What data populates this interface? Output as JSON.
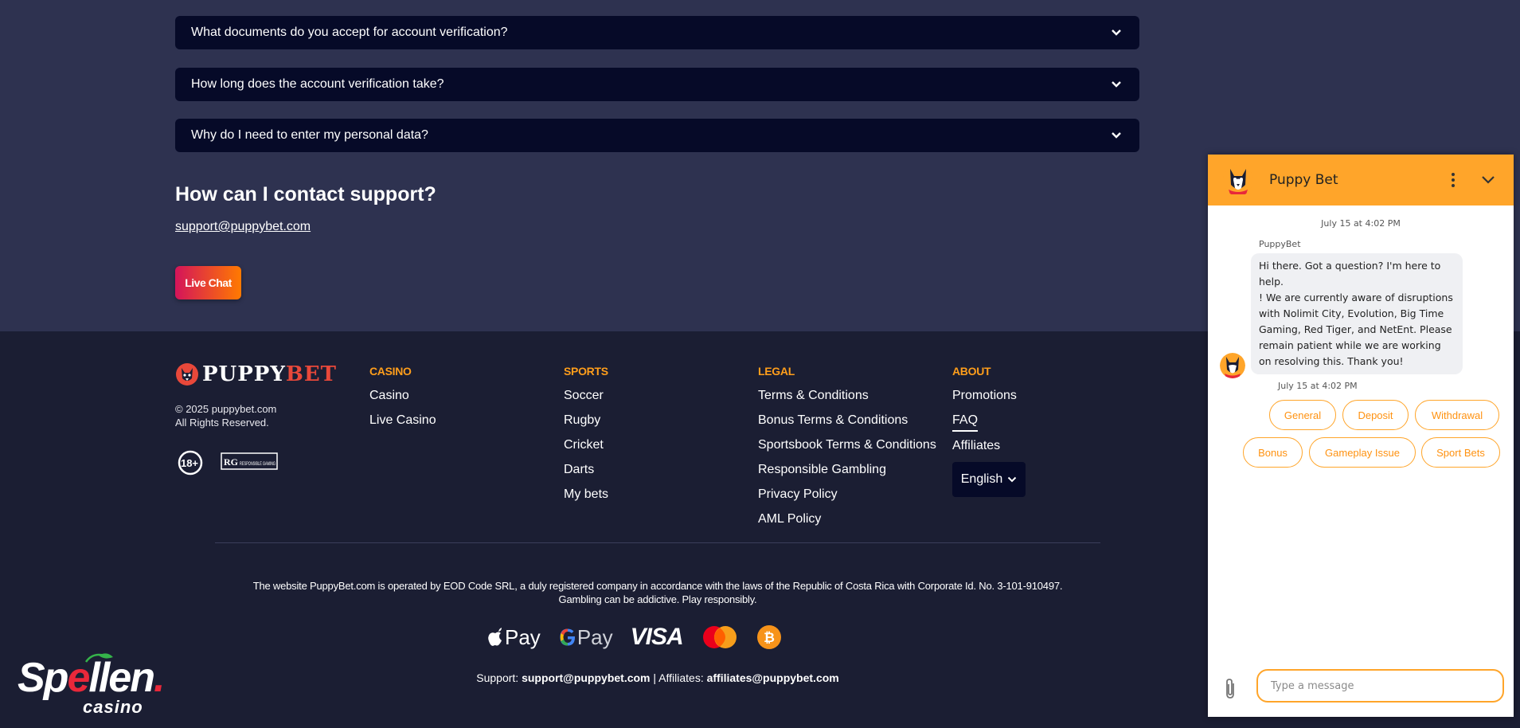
{
  "faq": {
    "items": [
      {
        "question": "What documents do you accept for account verification?"
      },
      {
        "question": "How long does the account verification take?"
      },
      {
        "question": "Why do I need to enter my personal data?"
      }
    ]
  },
  "contact": {
    "heading": "How can I contact support?",
    "email": "support@puppybet.com",
    "live_chat_label": "Live Chat"
  },
  "footer": {
    "brand": {
      "word1": "PUPPY",
      "word2": "BET"
    },
    "copyright_line1": "© 2025 puppybet.com",
    "copyright_line2": "All Rights Reserved.",
    "age_badge": "18+",
    "rg_badge": "RESPONSIBLE GAMING",
    "columns": {
      "casino": {
        "title": "CASINO",
        "links": [
          "Casino",
          "Live Casino"
        ]
      },
      "sports": {
        "title": "SPORTS",
        "links": [
          "Soccer",
          "Rugby",
          "Cricket",
          "Darts",
          "My bets"
        ]
      },
      "legal": {
        "title": "LEGAL",
        "links": [
          "Terms & Conditions",
          "Bonus Terms & Conditions",
          "Sportsbook Terms & Conditions",
          "Responsible Gambling",
          "Privacy Policy",
          "AML Policy"
        ]
      },
      "about": {
        "title": "ABOUT",
        "links": [
          "Promotions",
          "FAQ",
          "Affiliates"
        ]
      }
    },
    "language": "English",
    "legal_text_line1": "The website PuppyBet.com is operated by EOD Code SRL, a duly registered company in accordance with the laws of the Republic of Costa Rica with Corporate Id. No. 3-101-910497.",
    "legal_text_line2": "Gambling can be addictive. Play responsibly.",
    "payments": {
      "apple_pay": "Pay",
      "google_pay": "Pay",
      "visa": "VISA"
    },
    "support_prefix": "Support:",
    "support_email": "support@puppybet.com",
    "affiliates_prefix": "| Affiliates:",
    "affiliates_email": "affiliates@puppybet.com"
  },
  "watermark": {
    "line1_a": "Sp",
    "line1_e": "e",
    "line1_b": "llen",
    "line1_dot": ".",
    "line2": "casino"
  },
  "chat": {
    "title": "Puppy Bet",
    "timestamp1": "July 15 at 4:02 PM",
    "sender": "PuppyBet",
    "message_line1": "Hi there. Got a question? I'm here to help.",
    "message_line2": "! We are currently aware of disruptions with Nolimit City, Evolution, Big Time Gaming, Red Tiger, and NetEnt. Please remain patient while we are working on resolving this. Thank you!",
    "timestamp2": "July 15 at 4:02 PM",
    "quick_replies": [
      "General",
      "Deposit",
      "Withdrawal",
      "Bonus",
      "Gameplay Issue",
      "Sport Bets"
    ],
    "input_placeholder": "Type a message"
  },
  "colors": {
    "accent_orange": "#ffa52a",
    "column_heading": "#ff9e1b",
    "faq_bg": "#060a28",
    "page_bg": "#2e3250",
    "footer_bg": "#1b1e33"
  }
}
